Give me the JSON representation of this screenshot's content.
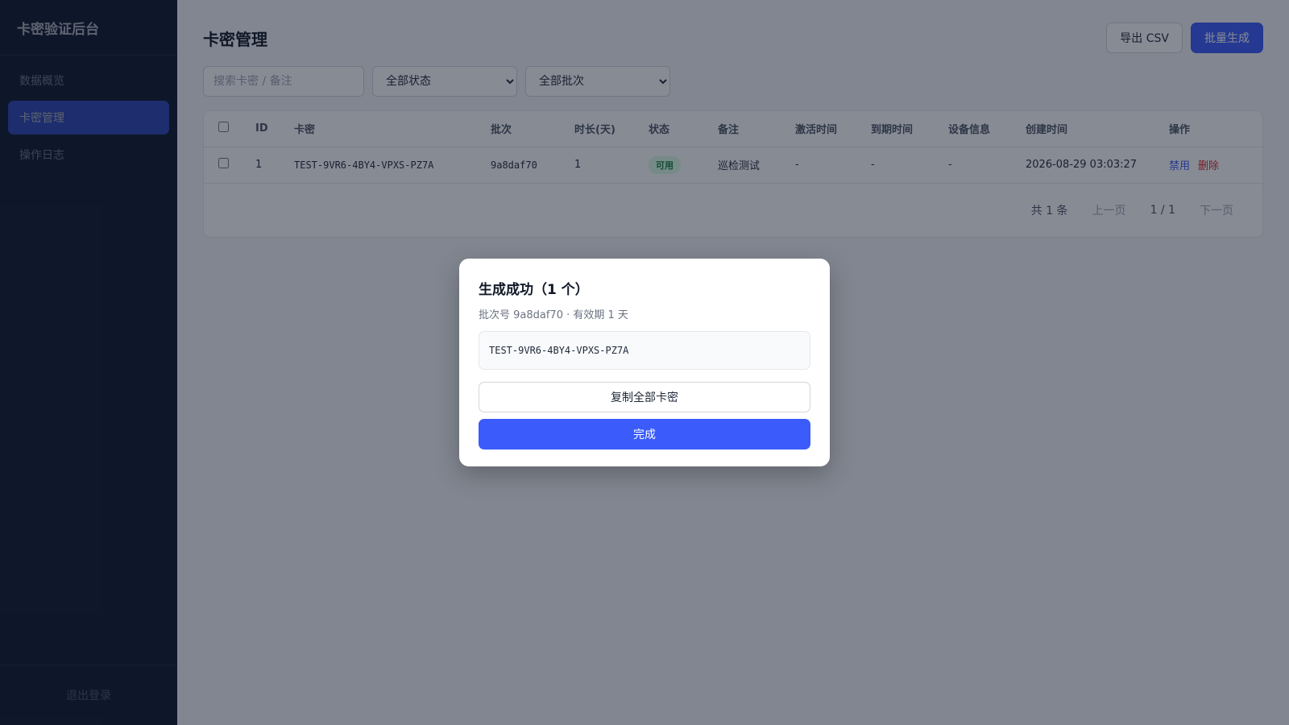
{
  "sidebar": {
    "brand": "卡密验证后台",
    "items": [
      {
        "label": "数据概览"
      },
      {
        "label": "卡密管理"
      },
      {
        "label": "操作日志"
      }
    ],
    "logout": "退出登录"
  },
  "header": {
    "title": "卡密管理",
    "export_label": "导出 CSV",
    "generate_label": "批量生成"
  },
  "filters": {
    "search_placeholder": "搜索卡密 / 备注",
    "status_selected": "全部状态",
    "batch_selected": "全部批次"
  },
  "table": {
    "columns": [
      "ID",
      "卡密",
      "批次",
      "时长(天)",
      "状态",
      "备注",
      "激活时间",
      "到期时间",
      "设备信息",
      "创建时间",
      "操作"
    ],
    "rows": [
      {
        "id": "1",
        "key": "TEST-9VR6-4BY4-VPXS-PZ7A",
        "batch": "9a8daf70",
        "days": "1",
        "status": "可用",
        "note": "巡检测试",
        "activated": "-",
        "expires": "-",
        "device": "-",
        "created": "2026-08-29 03:03:27",
        "action_disable": "禁用",
        "action_delete": "删除"
      }
    ]
  },
  "pager": {
    "total": "共 1 条",
    "prev": "上一页",
    "page": "1 / 1",
    "next": "下一页"
  },
  "modal": {
    "title": "生成成功（1 个）",
    "subtitle": "批次号 9a8daf70 · 有效期 1 天",
    "keys": "TEST-9VR6-4BY4-VPXS-PZ7A",
    "copy_label": "复制全部卡密",
    "done_label": "完成"
  },
  "colors": {
    "accent": "#3b5bfa",
    "sidebar_bg": "#0f172a",
    "danger": "#dc2626",
    "success": "#15803d"
  }
}
